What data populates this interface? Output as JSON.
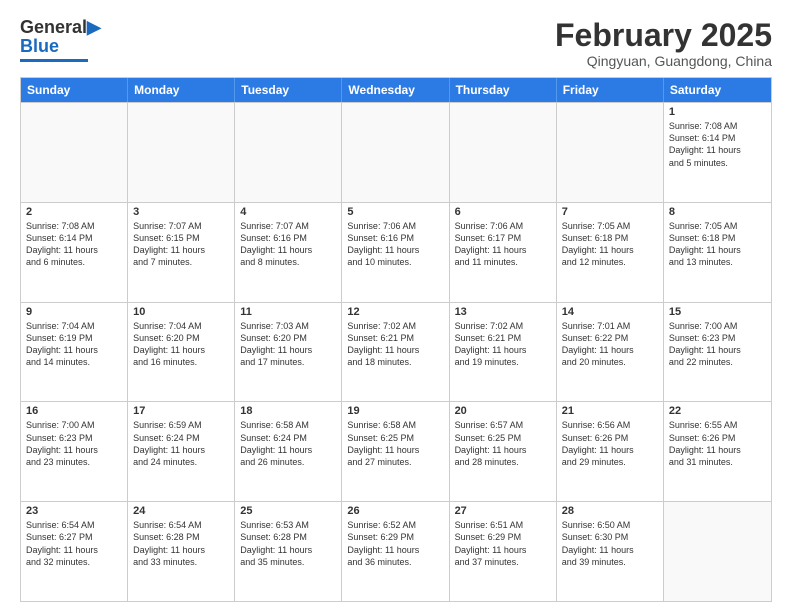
{
  "header": {
    "logo_line1": "General",
    "logo_line2": "Blue",
    "month_year": "February 2025",
    "location": "Qingyuan, Guangdong, China"
  },
  "weekdays": [
    "Sunday",
    "Monday",
    "Tuesday",
    "Wednesday",
    "Thursday",
    "Friday",
    "Saturday"
  ],
  "rows": [
    [
      {
        "day": "",
        "text": ""
      },
      {
        "day": "",
        "text": ""
      },
      {
        "day": "",
        "text": ""
      },
      {
        "day": "",
        "text": ""
      },
      {
        "day": "",
        "text": ""
      },
      {
        "day": "",
        "text": ""
      },
      {
        "day": "1",
        "text": "Sunrise: 7:08 AM\nSunset: 6:14 PM\nDaylight: 11 hours\nand 5 minutes."
      }
    ],
    [
      {
        "day": "2",
        "text": "Sunrise: 7:08 AM\nSunset: 6:14 PM\nDaylight: 11 hours\nand 6 minutes."
      },
      {
        "day": "3",
        "text": "Sunrise: 7:07 AM\nSunset: 6:15 PM\nDaylight: 11 hours\nand 7 minutes."
      },
      {
        "day": "4",
        "text": "Sunrise: 7:07 AM\nSunset: 6:16 PM\nDaylight: 11 hours\nand 8 minutes."
      },
      {
        "day": "5",
        "text": "Sunrise: 7:06 AM\nSunset: 6:16 PM\nDaylight: 11 hours\nand 10 minutes."
      },
      {
        "day": "6",
        "text": "Sunrise: 7:06 AM\nSunset: 6:17 PM\nDaylight: 11 hours\nand 11 minutes."
      },
      {
        "day": "7",
        "text": "Sunrise: 7:05 AM\nSunset: 6:18 PM\nDaylight: 11 hours\nand 12 minutes."
      },
      {
        "day": "8",
        "text": "Sunrise: 7:05 AM\nSunset: 6:18 PM\nDaylight: 11 hours\nand 13 minutes."
      }
    ],
    [
      {
        "day": "9",
        "text": "Sunrise: 7:04 AM\nSunset: 6:19 PM\nDaylight: 11 hours\nand 14 minutes."
      },
      {
        "day": "10",
        "text": "Sunrise: 7:04 AM\nSunset: 6:20 PM\nDaylight: 11 hours\nand 16 minutes."
      },
      {
        "day": "11",
        "text": "Sunrise: 7:03 AM\nSunset: 6:20 PM\nDaylight: 11 hours\nand 17 minutes."
      },
      {
        "day": "12",
        "text": "Sunrise: 7:02 AM\nSunset: 6:21 PM\nDaylight: 11 hours\nand 18 minutes."
      },
      {
        "day": "13",
        "text": "Sunrise: 7:02 AM\nSunset: 6:21 PM\nDaylight: 11 hours\nand 19 minutes."
      },
      {
        "day": "14",
        "text": "Sunrise: 7:01 AM\nSunset: 6:22 PM\nDaylight: 11 hours\nand 20 minutes."
      },
      {
        "day": "15",
        "text": "Sunrise: 7:00 AM\nSunset: 6:23 PM\nDaylight: 11 hours\nand 22 minutes."
      }
    ],
    [
      {
        "day": "16",
        "text": "Sunrise: 7:00 AM\nSunset: 6:23 PM\nDaylight: 11 hours\nand 23 minutes."
      },
      {
        "day": "17",
        "text": "Sunrise: 6:59 AM\nSunset: 6:24 PM\nDaylight: 11 hours\nand 24 minutes."
      },
      {
        "day": "18",
        "text": "Sunrise: 6:58 AM\nSunset: 6:24 PM\nDaylight: 11 hours\nand 26 minutes."
      },
      {
        "day": "19",
        "text": "Sunrise: 6:58 AM\nSunset: 6:25 PM\nDaylight: 11 hours\nand 27 minutes."
      },
      {
        "day": "20",
        "text": "Sunrise: 6:57 AM\nSunset: 6:25 PM\nDaylight: 11 hours\nand 28 minutes."
      },
      {
        "day": "21",
        "text": "Sunrise: 6:56 AM\nSunset: 6:26 PM\nDaylight: 11 hours\nand 29 minutes."
      },
      {
        "day": "22",
        "text": "Sunrise: 6:55 AM\nSunset: 6:26 PM\nDaylight: 11 hours\nand 31 minutes."
      }
    ],
    [
      {
        "day": "23",
        "text": "Sunrise: 6:54 AM\nSunset: 6:27 PM\nDaylight: 11 hours\nand 32 minutes."
      },
      {
        "day": "24",
        "text": "Sunrise: 6:54 AM\nSunset: 6:28 PM\nDaylight: 11 hours\nand 33 minutes."
      },
      {
        "day": "25",
        "text": "Sunrise: 6:53 AM\nSunset: 6:28 PM\nDaylight: 11 hours\nand 35 minutes."
      },
      {
        "day": "26",
        "text": "Sunrise: 6:52 AM\nSunset: 6:29 PM\nDaylight: 11 hours\nand 36 minutes."
      },
      {
        "day": "27",
        "text": "Sunrise: 6:51 AM\nSunset: 6:29 PM\nDaylight: 11 hours\nand 37 minutes."
      },
      {
        "day": "28",
        "text": "Sunrise: 6:50 AM\nSunset: 6:30 PM\nDaylight: 11 hours\nand 39 minutes."
      },
      {
        "day": "",
        "text": ""
      }
    ]
  ]
}
